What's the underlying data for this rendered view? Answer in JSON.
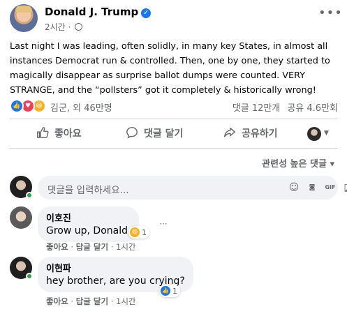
{
  "post": {
    "author": "Donald J. Trump",
    "time": "2시간",
    "text": "Last night I was leading, often solidly, in many key States, in almost all instances Democrat run & controlled. Then, one by one, they started to magically disappear as surprise ballot dumps were counted. VERY STRANGE, and the “pollsters” got it completely & historically wrong!",
    "reactions_text": "김군, 외 46만명",
    "comments_count": "댓글 12만개",
    "shares_count": "공유 4.6만회"
  },
  "actions": {
    "like": "좋아요",
    "comment": "댓글 달기",
    "share": "공유하기"
  },
  "sort_label": "관련성 높은 댓글",
  "composer": {
    "placeholder": "댓글을 입력하세요..."
  },
  "comments": [
    {
      "name": "이호진",
      "text": "Grow up, Donald.",
      "reaction_count": "1",
      "like": "좋아요",
      "reply": "답글 달기",
      "time": "1시간"
    },
    {
      "name": "이현파",
      "text": "hey brother, are you crying?",
      "reaction_count": "1",
      "like": "좋아요",
      "reply": "답글 달기",
      "time": "1시간"
    }
  ],
  "icons": [
    "verified-icon",
    "globe-icon",
    "more-icon",
    "like-reaction-icon",
    "love-reaction-icon",
    "haha-reaction-icon",
    "thumbs-up-icon",
    "comment-icon",
    "share-icon",
    "emoji-icon",
    "camera-icon",
    "gif-icon",
    "sticker-icon"
  ],
  "colors": {
    "accent": "#1877f2",
    "text_secondary": "#65676b",
    "bubble": "#f0f2f5",
    "online": "#31a24c"
  }
}
